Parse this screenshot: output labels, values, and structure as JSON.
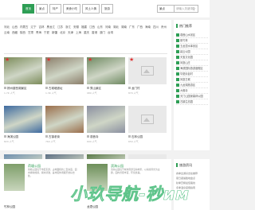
{
  "topbar": {
    "tabs": [
      "首页",
      "景点",
      "特产",
      "美食小吃",
      "风土人情",
      "旅游"
    ],
    "search": {
      "select_label": "景点",
      "placeholder": "请输入关键词"
    }
  },
  "regions": [
    "河北",
    "山西",
    "内蒙古",
    "辽宁",
    "吉林",
    "黑龙江",
    "江苏",
    "浙江",
    "安徽",
    "福建",
    "江西",
    "山东",
    "河南",
    "湖北",
    "湖南",
    "广东",
    "广西",
    "海南",
    "四川",
    "贵州",
    "云南",
    "西藏",
    "陕西",
    "甘肃",
    "青海",
    "宁夏",
    "新疆",
    "北京",
    "天津",
    "上海",
    "重庆",
    "香港",
    "澳门",
    "台湾"
  ],
  "cards": [
    {
      "title": "扬州瘦西湖景区",
      "meta": "1.7K  人气",
      "placeholder": false,
      "star": true,
      "color": "#7c8c5a"
    },
    {
      "title": "古城墙遗址",
      "meta": "1.3K  人气",
      "placeholder": false,
      "star": true,
      "color": "#8b7e6a"
    },
    {
      "title": "秀山景区",
      "meta": "980  人气",
      "placeholder": false,
      "star": true,
      "color": "#6f8a62"
    },
    {
      "title": "龙门村",
      "meta": "870  人气",
      "placeholder": true,
      "star": true,
      "color": "#e9e9e9"
    },
    {
      "title": "海滨公园",
      "meta": "820  人气",
      "placeholder": false,
      "star": false,
      "color": "#3e6aa0"
    },
    {
      "title": "古镇老街",
      "meta": "760  人气",
      "placeholder": false,
      "star": false,
      "color": "#9a6d4a"
    },
    {
      "title": "观音寺",
      "meta": "690  人气",
      "placeholder": false,
      "star": false,
      "color": "#8a8fa0"
    },
    {
      "title": "石林公园",
      "meta": "650  人气",
      "placeholder": true,
      "star": false,
      "color": "#e9e9e9"
    },
    {
      "title": "湖畔湿地公园",
      "meta": "610  人气",
      "placeholder": false,
      "star": false,
      "color": "#6e8fae"
    },
    {
      "title": "海上日出",
      "meta": "580  人气",
      "placeholder": false,
      "star": false,
      "color": "#5d6f84"
    },
    {
      "title": "森林公园",
      "meta": "540  人气",
      "placeholder": false,
      "star": false,
      "color": "#5a7a4a"
    },
    {
      "title": "古村落",
      "meta": "500  人气",
      "placeholder": true,
      "star": false,
      "color": "#e9e9e9"
    }
  ],
  "sidebar": {
    "title": "热门推荐",
    "items": [
      "观音山水景区",
      "紫竹林",
      "五龙潭水库景区",
      "碧云公园",
      "天宝文化园",
      "凤凰山庄",
      "海滨国际旅游度假区",
      "华夏民俗村",
      "凤凰古城",
      "九龙湖旅游区",
      "大佛寺",
      "天门山国家森林公园",
      "古镇生态园"
    ]
  },
  "news": [
    {
      "title": "荷塘公园",
      "text": "荷塘公园位于市区东部，占地面积约二百余亩，园内绿树成荫，湖水清澈，是市民休闲娱乐的好去处。",
      "sub": "竹林公园",
      "color": "#7e9e6a"
    },
    {
      "title": "滨海公园",
      "text": "滨海公园位于城市南部沿海地带，以海滨风光为主题，园内景观丰富，环境优美。",
      "sub": "龙潭公园",
      "color": "#6d8f5a"
    }
  ],
  "side2": {
    "title": "旅游资讯",
    "items": [
      "春季出游好去处推荐",
      "夏日避暑胜地盘点",
      "秋季赏枫最佳路线",
      "冬季温泉度假指南"
    ]
  },
  "watermark": "小玖导航-秒им"
}
